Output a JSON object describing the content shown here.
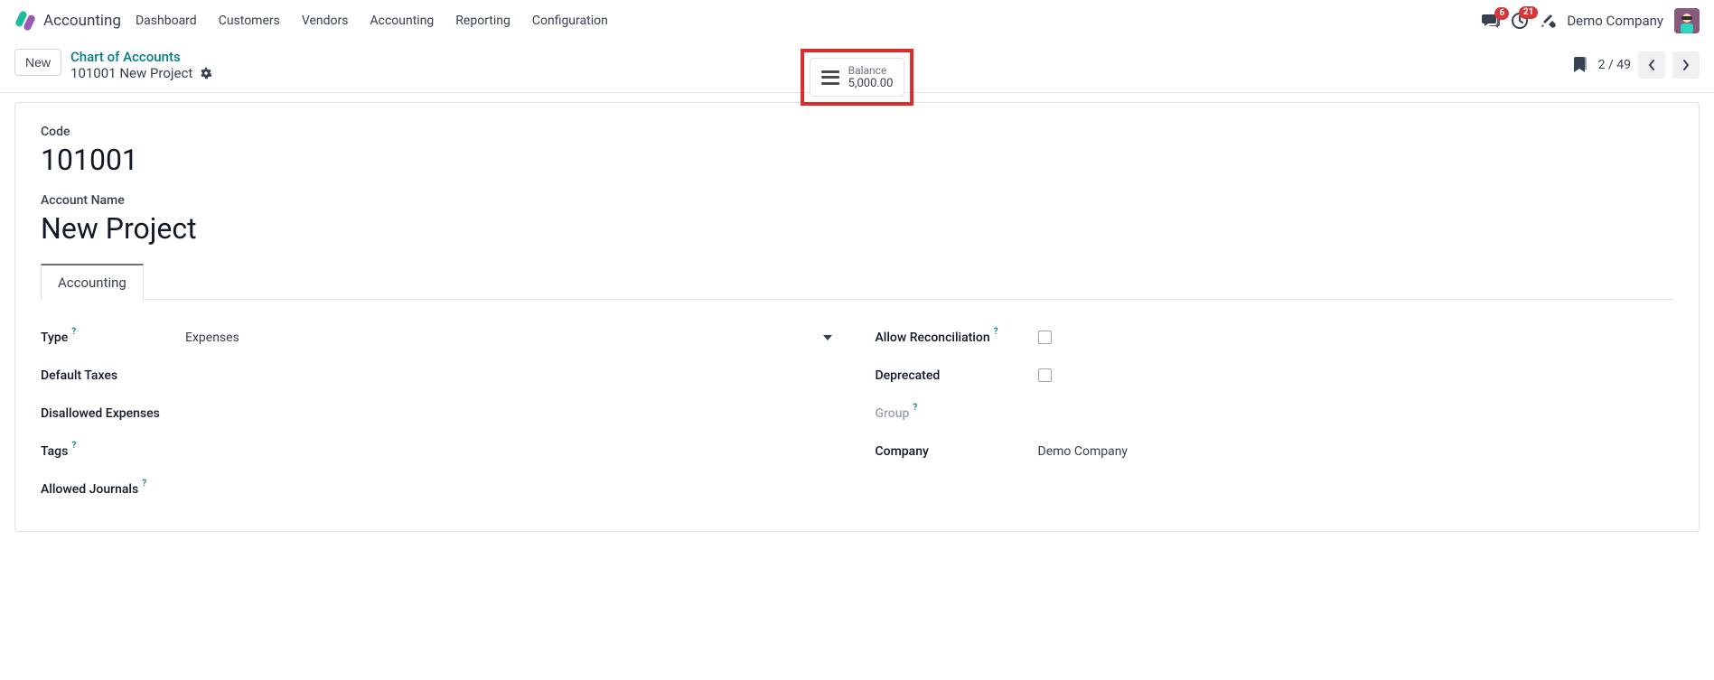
{
  "topnav": {
    "app_name": "Accounting",
    "menu": [
      "Dashboard",
      "Customers",
      "Vendors",
      "Accounting",
      "Reporting",
      "Configuration"
    ],
    "notif_messages_badge": "6",
    "notif_activities_badge": "21",
    "company_name": "Demo Company"
  },
  "control_panel": {
    "new_button": "New",
    "breadcrumb_parent": "Chart of Accounts",
    "breadcrumb_current": "101001 New Project",
    "stat_label": "Balance",
    "stat_value": "5,000.00",
    "pager_text": "2 / 49"
  },
  "form": {
    "code_label": "Code",
    "code_value": "101001",
    "name_label": "Account Name",
    "name_value": "New Project",
    "tab_accounting": "Accounting",
    "left_col": {
      "type_label": "Type",
      "type_value": "Expenses",
      "default_taxes_label": "Default Taxes",
      "disallowed_expenses_label": "Disallowed Expenses",
      "tags_label": "Tags",
      "allowed_journals_label": "Allowed Journals"
    },
    "right_col": {
      "allow_reconciliation_label": "Allow Reconciliation",
      "deprecated_label": "Deprecated",
      "group_label": "Group",
      "company_label": "Company",
      "company_value": "Demo Company"
    }
  }
}
